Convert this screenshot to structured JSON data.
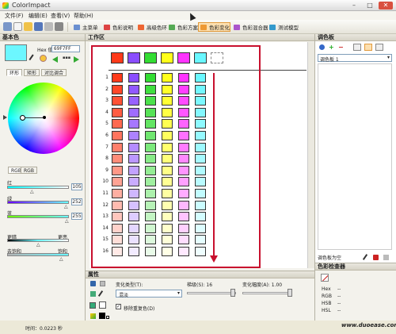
{
  "app": {
    "title": "ColorImpact"
  },
  "window_controls": {
    "minimize": "–",
    "maximize": "□",
    "close": "✕"
  },
  "menu": [
    "文件(F)",
    "编辑(E)",
    "查看(V)",
    "帮助(H)"
  ],
  "toolbar_tabs": [
    {
      "label": "主菜单",
      "icon_color": "#6a8fd0"
    },
    {
      "label": "色彩说明",
      "icon_color": "#d44"
    },
    {
      "label": "高级色环",
      "icon_color": "#e63"
    },
    {
      "label": "色彩方案",
      "icon_color": "#5a5"
    },
    {
      "label": "色彩变化",
      "icon_color": "#e93",
      "active": true
    },
    {
      "label": "色彩混合器",
      "icon_color": "#a5c"
    },
    {
      "label": "测试模型",
      "icon_color": "#39c"
    }
  ],
  "left_panel": {
    "header": "基本色",
    "hex_label": "Hex 值:",
    "hex_value": "69F7FF",
    "current_color": "#6cf7ff",
    "sub_tabs": [
      "环形",
      "矩形",
      "对比调合"
    ],
    "mode_tabs": [
      "RGB",
      "RGB"
    ],
    "channels": [
      {
        "label": "红",
        "value": "105"
      },
      {
        "label": "绿",
        "value": "252"
      },
      {
        "label": "蓝",
        "value": "255"
      }
    ],
    "darker_label": "更暗",
    "lighter_label": "更亮",
    "desat_label": "去饱和",
    "sat_label": "饱和"
  },
  "workspace": {
    "header": "工作区",
    "base_colors": [
      "#ff3a1a",
      "#8a4dff",
      "#33dd33",
      "#ffff1a",
      "#ff33ff",
      "#69f7ff"
    ],
    "row_labels": [
      "1",
      "2",
      "3",
      "4",
      "5",
      "6",
      "7",
      "8",
      "9",
      "10",
      "11",
      "12",
      "13",
      "14",
      "15",
      "16"
    ]
  },
  "properties": {
    "header": "属性",
    "variation_type_label": "变化类型(T):",
    "variation_type_value": "混淡",
    "steps_label": "梯级(S): 16",
    "opacity_label": "变化幅度(A): 1.00",
    "remove_duplicates": "移除重复色(D)"
  },
  "right_panel": {
    "header": "调色板",
    "palette_select": "调色板 1",
    "empty_label": "调色板为空",
    "analyzer_header": "色彩检查器",
    "analyzer_rows": [
      {
        "label": "Hex",
        "value": "--"
      },
      {
        "label": "RGB",
        "value": "--"
      },
      {
        "label": "HSB",
        "value": "--"
      },
      {
        "label": "HSL",
        "value": "--"
      }
    ]
  },
  "status": {
    "time": "时间：0.0223 秒"
  },
  "watermark": "www.duoease.com"
}
